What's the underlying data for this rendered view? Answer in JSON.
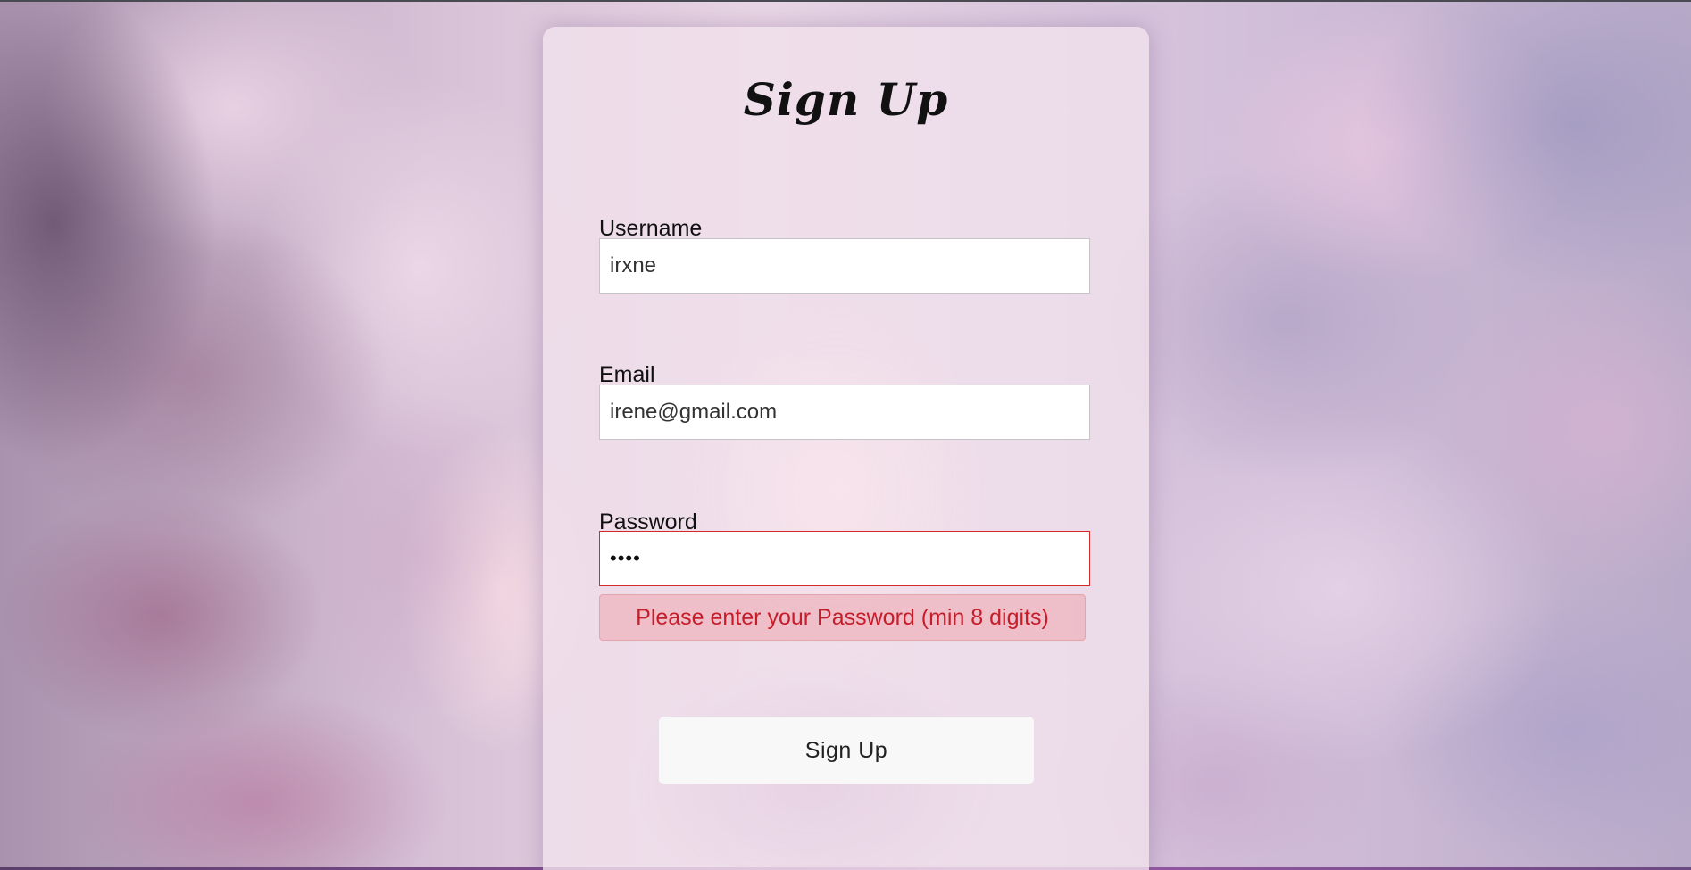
{
  "form": {
    "title": "Sign Up",
    "username": {
      "label": "Username",
      "value": "irxne"
    },
    "email": {
      "label": "Email",
      "value": "irene@gmail.com"
    },
    "password": {
      "label": "Password",
      "value": "••••",
      "error": "Please enter your Password (min 8 digits)"
    },
    "submit_label": "Sign Up"
  },
  "colors": {
    "error_text": "#c51e2a",
    "error_border": "#d42a2a",
    "error_background": "#eeb4be",
    "button_background": "#f9f8f8"
  }
}
